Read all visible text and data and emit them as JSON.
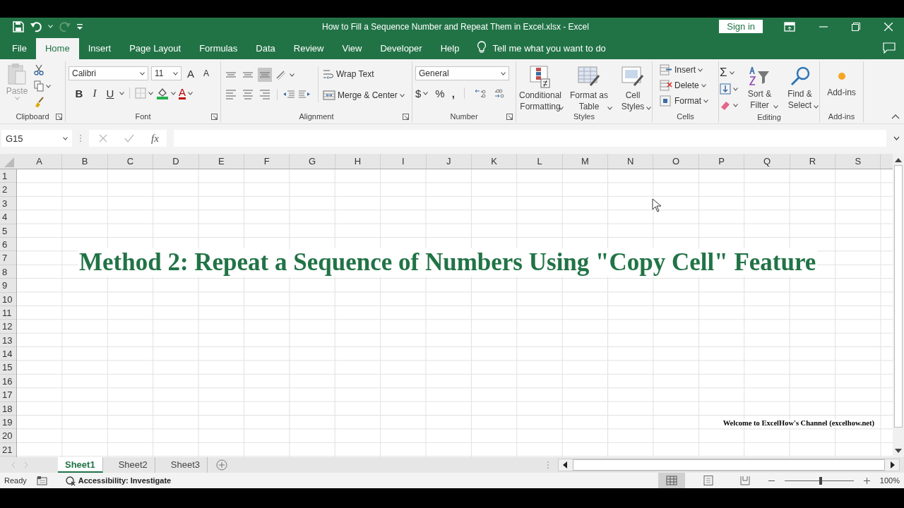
{
  "window": {
    "title": "How to Fill a Sequence Number and Repeat Them in Excel.xlsx  -  Excel",
    "sign_in": "Sign in"
  },
  "tabs": [
    {
      "label": "File",
      "selected": false
    },
    {
      "label": "Home",
      "selected": true
    },
    {
      "label": "Insert",
      "selected": false
    },
    {
      "label": "Page Layout",
      "selected": false
    },
    {
      "label": "Formulas",
      "selected": false
    },
    {
      "label": "Data",
      "selected": false
    },
    {
      "label": "Review",
      "selected": false
    },
    {
      "label": "View",
      "selected": false
    },
    {
      "label": "Developer",
      "selected": false
    },
    {
      "label": "Help",
      "selected": false
    }
  ],
  "tell_me": "Tell me what you want to do",
  "ribbon": {
    "clipboard": {
      "label": "Clipboard",
      "paste": "Paste"
    },
    "font": {
      "label": "Font",
      "font_name": "Calibri",
      "font_size": "11",
      "grow": "A",
      "shrink": "A",
      "bold": "B",
      "italic": "I",
      "underline": "U",
      "font_color": "A"
    },
    "alignment": {
      "label": "Alignment",
      "wrap_text": "Wrap Text",
      "merge": "Merge & Center"
    },
    "number": {
      "label": "Number",
      "format": "General",
      "currency": "$",
      "percent": "%",
      "comma": ","
    },
    "styles": {
      "label": "Styles",
      "buttons": [
        "Conditional Formatting",
        "Format as Table",
        "Cell Styles"
      ]
    },
    "cells": {
      "label": "Cells",
      "buttons": [
        "Insert",
        "Delete",
        "Format"
      ]
    },
    "editing": {
      "label": "Editing",
      "sum": "Σ",
      "buttons": [
        "Sort & Filter",
        "Find & Select"
      ]
    },
    "addins": {
      "label": "Add-ins",
      "button": "Add-ins"
    }
  },
  "name_box": "G15",
  "function_label": "fx",
  "columns": [
    "A",
    "B",
    "C",
    "D",
    "E",
    "F",
    "G",
    "H",
    "I",
    "J",
    "K",
    "L",
    "M",
    "N",
    "O",
    "P",
    "Q",
    "R",
    "S"
  ],
  "rows": [
    "1",
    "2",
    "3",
    "4",
    "5",
    "6",
    "7",
    "8",
    "9",
    "10",
    "11",
    "12",
    "13",
    "14",
    "15",
    "16",
    "17",
    "18",
    "19",
    "20",
    "21"
  ],
  "heading": "Method 2: Repeat a Sequence of Numbers Using \"Copy Cell\" Feature",
  "credit": "Welcome to ExcelHow's  Channel (excelhow.net)",
  "sheets": [
    {
      "label": "Sheet1",
      "selected": true
    },
    {
      "label": "Sheet2",
      "selected": false
    },
    {
      "label": "Sheet3",
      "selected": false
    }
  ],
  "status": {
    "ready": "Ready",
    "accessibility": "Accessibility: Investigate",
    "zoom": "100%",
    "zoom_level": {
      "level": 0.5
    },
    "views": [
      {
        "kind": "normal",
        "selected": true
      },
      {
        "kind": "page-layout",
        "selected": false
      },
      {
        "kind": "page-break",
        "selected": false
      }
    ]
  }
}
